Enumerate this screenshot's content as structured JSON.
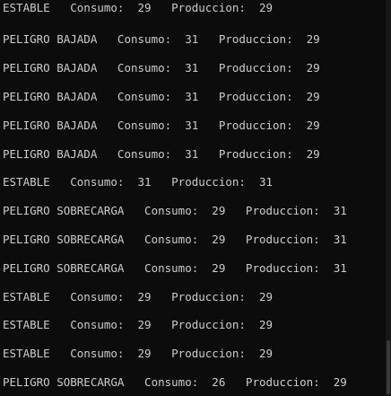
{
  "console": {
    "lines": [
      "ESTABLE   Consumo:  29   Produccion:  29",
      "PELIGRO BAJADA   Consumo:  31   Produccion:  29",
      "PELIGRO BAJADA   Consumo:  31   Produccion:  29",
      "PELIGRO BAJADA   Consumo:  31   Produccion:  29",
      "PELIGRO BAJADA   Consumo:  31   Produccion:  29",
      "PELIGRO BAJADA   Consumo:  31   Produccion:  29",
      "ESTABLE   Consumo:  31   Produccion:  31",
      "PELIGRO SOBRECARGA   Consumo:  29   Produccion:  31",
      "PELIGRO SOBRECARGA   Consumo:  29   Produccion:  31",
      "PELIGRO SOBRECARGA   Consumo:  29   Produccion:  31",
      "ESTABLE   Consumo:  29   Produccion:  29",
      "ESTABLE   Consumo:  29   Produccion:  29",
      "ESTABLE   Consumo:  29   Produccion:  29",
      "PELIGRO SOBRECARGA   Consumo:  26   Produccion:  29"
    ]
  },
  "colors": {
    "background": "#0c0c0c",
    "text": "#cccccc"
  }
}
